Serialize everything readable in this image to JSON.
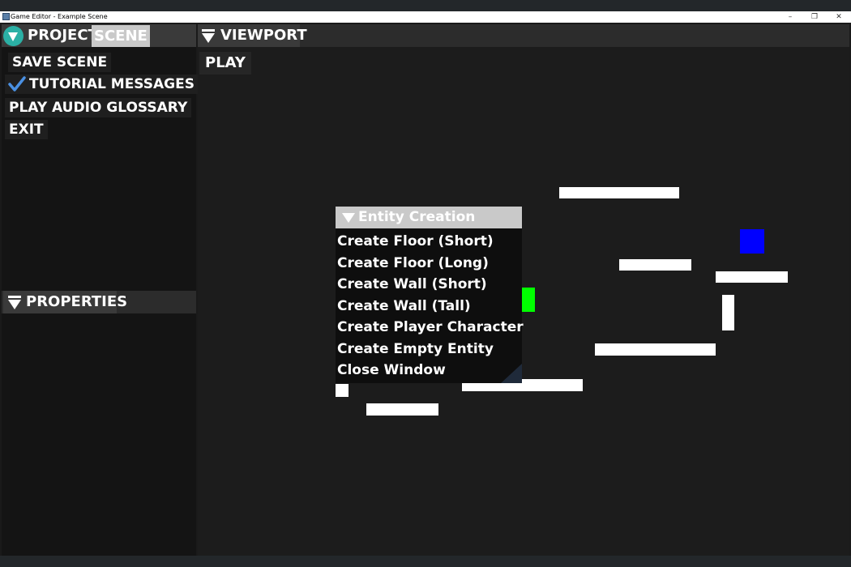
{
  "window": {
    "title": "Game Editor - Example Scene",
    "controls": {
      "minimize": "–",
      "restore": "❐",
      "close": "✕"
    }
  },
  "left_panel": {
    "tabs": {
      "project": "PROJECT",
      "scene": "SCENE"
    },
    "menu": {
      "save_scene": "SAVE SCENE",
      "tutorial_messages": "TUTORIAL MESSAGES",
      "tutorial_messages_checked": true,
      "play_audio_glossary": "PLAY AUDIO GLOSSARY",
      "exit": "EXIT"
    }
  },
  "properties_panel": {
    "title": "PROPERTIES"
  },
  "viewport": {
    "title": "VIEWPORT",
    "play_label": "PLAY"
  },
  "entity_creation": {
    "title": "Entity Creation",
    "options": [
      "Create Floor (Short)",
      "Create Floor (Long)",
      "Create Wall (Short)",
      "Create Wall (Tall)",
      "Create Player Character",
      "Create Empty Entity",
      "Close Window"
    ]
  },
  "colors": {
    "accent_logo": "#2bb0a5",
    "tab_selected": "#c9c9c9",
    "checkmark": "#4a90e2",
    "player_entity": "#0000ff",
    "green_entity": "#00ff00",
    "platform": "#ffffff"
  },
  "icons": {
    "logo": "logo-icon",
    "checkbox": "check-icon",
    "collapse": "collapse-arrow-icon"
  }
}
